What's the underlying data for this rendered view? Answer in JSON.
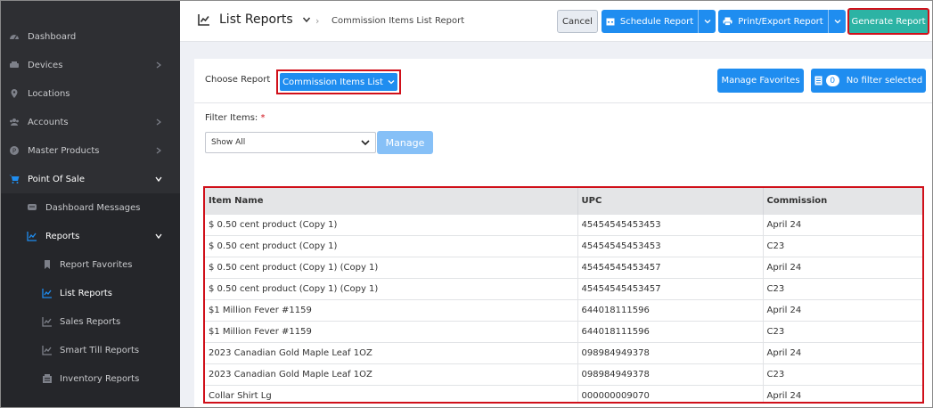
{
  "sidebar": {
    "items": [
      {
        "label": "Dashboard",
        "icon": "dashboard-icon"
      },
      {
        "label": "Devices",
        "icon": "devices-icon"
      },
      {
        "label": "Locations",
        "icon": "location-pin-icon"
      },
      {
        "label": "Accounts",
        "icon": "users-icon"
      },
      {
        "label": "Master Products",
        "icon": "product-icon"
      },
      {
        "label": "Point Of Sale",
        "icon": "cart-icon"
      },
      {
        "label": "Dashboard Messages",
        "icon": "message-icon"
      },
      {
        "label": "Reports",
        "icon": "chart-icon"
      },
      {
        "label": "Report Favorites",
        "icon": "bookmark-icon"
      },
      {
        "label": "List Reports",
        "icon": "chart-icon"
      },
      {
        "label": "Sales Reports",
        "icon": "chart-icon"
      },
      {
        "label": "Smart Till Reports",
        "icon": "chart-icon"
      },
      {
        "label": "Inventory Reports",
        "icon": "inventory-icon"
      }
    ]
  },
  "header": {
    "title": "List Reports",
    "breadcrumb": "Commission Items List Report",
    "cancel_label": "Cancel",
    "schedule_label": "Schedule Report",
    "print_label": "Print/Export Report",
    "generate_label": "Generate Report"
  },
  "panel": {
    "choose_label": "Choose Report",
    "report_selected": "Commission Items List",
    "manage_favorites_label": "Manage Favorites",
    "filter_count": "0",
    "filter_status": "No filter selected",
    "filter_items_label": "Filter Items:",
    "required_mark": "*",
    "filter_select_value": "Show All",
    "manage_label": "Manage"
  },
  "table": {
    "columns": [
      "Item Name",
      "UPC",
      "Commission"
    ],
    "rows": [
      [
        "$ 0.50 cent product (Copy 1)",
        "45454545453453",
        "April 24"
      ],
      [
        "$ 0.50 cent product (Copy 1)",
        "45454545453453",
        "C23"
      ],
      [
        "$ 0.50 cent product (Copy 1) (Copy 1)",
        "45454545453457",
        "April 24"
      ],
      [
        "$ 0.50 cent product (Copy 1) (Copy 1)",
        "45454545453457",
        "C23"
      ],
      [
        "$1 Million Fever #1159",
        "644018111596",
        "April 24"
      ],
      [
        "$1 Million Fever #1159",
        "644018111596",
        "C23"
      ],
      [
        "2023 Canadian Gold Maple Leaf 1OZ",
        "098984949378",
        "April 24"
      ],
      [
        "2023 Canadian Gold Maple Leaf 1OZ",
        "098984949378",
        "C23"
      ],
      [
        "Collar Shirt Lg",
        "000000009070",
        "April 24"
      ]
    ]
  },
  "colors": {
    "sidebar_bg": "#2e2f33",
    "primary_blue": "#1f8df0",
    "generate_teal": "#2cb3a4",
    "highlight_red": "#d0101a"
  }
}
